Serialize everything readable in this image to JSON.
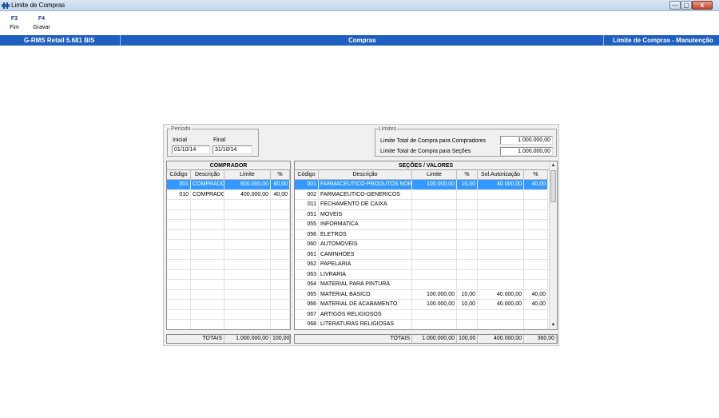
{
  "window": {
    "title": "Limite de Compras",
    "controls": {
      "minimize": "—",
      "maximize": "▢",
      "close": "x"
    }
  },
  "toolbar": [
    {
      "key": "F3",
      "label": "Fim"
    },
    {
      "key": "F4",
      "label": "Gravar"
    }
  ],
  "header": {
    "left": "G-RMS Retail 5.681 BIS",
    "center": "Compras",
    "right": "Limite de Compras - Manutenção"
  },
  "periodo": {
    "legend": "Período",
    "inicial_label": "Inicial",
    "final_label": "Final",
    "inicial": "01/10/14",
    "final": "31/10/14"
  },
  "limites": {
    "legend": "Limites",
    "compradores_label": "Limite Total de Compra para Compradores",
    "compradores_value": "1.000.000,00",
    "secoes_label": "Limite Total de Compra para Seções",
    "secoes_value": "1.000.000,00"
  },
  "comprador": {
    "title": "COMPRADOR",
    "columns": [
      "Código",
      "Descrição",
      "Limite",
      "%"
    ],
    "rows": [
      [
        "001",
        "COMPRADOI",
        "600.000,00",
        "60,00"
      ],
      [
        "010",
        "COMPRADOI",
        "400.000,00",
        "40,00"
      ]
    ],
    "totals": {
      "label": "TOTAIS",
      "limite": "1.000.000,00",
      "pct": "100,00"
    }
  },
  "secoes": {
    "title": "SEÇÕES / VALORES",
    "columns": [
      "Código",
      "Descrição",
      "Limite",
      "%",
      "Sol.Autorização",
      "%"
    ],
    "rows": [
      [
        "001",
        "FARMACEUTICO-PRODUTOS NORMA",
        "100.000,00",
        "10,00",
        "40.000,00",
        "40,00"
      ],
      [
        "002",
        "FARMACEUTICO-GENERICOS",
        "",
        "",
        "",
        ""
      ],
      [
        "011",
        "FECHAMENTO DE CAIXA",
        "",
        "",
        "",
        ""
      ],
      [
        "051",
        "MOVEIS",
        "",
        "",
        "",
        ""
      ],
      [
        "055",
        "INFORMATICA",
        "",
        "",
        "",
        ""
      ],
      [
        "056",
        "ELETROS",
        "",
        "",
        "",
        ""
      ],
      [
        "060",
        "AUTOMOVEIS",
        "",
        "",
        "",
        ""
      ],
      [
        "061",
        "CAMINHOES",
        "",
        "",
        "",
        ""
      ],
      [
        "062",
        "PAPELARIA",
        "",
        "",
        "",
        ""
      ],
      [
        "063",
        "LIVRARIA",
        "",
        "",
        "",
        ""
      ],
      [
        "064",
        "MATERIAL PARA PINTURA",
        "",
        "",
        "",
        ""
      ],
      [
        "065",
        "MATERIAL BASICO",
        "100.000,00",
        "10,00",
        "40.000,00",
        "40,00"
      ],
      [
        "066",
        "MATERIAL DE ACABAMENTO",
        "100.000,00",
        "10,00",
        "40.000,00",
        "40,00"
      ],
      [
        "067",
        "ARTIGOS RELIGIOSOS",
        "",
        "",
        "",
        ""
      ],
      [
        "068",
        "LITERATURAS RELIGIOSAS",
        "",
        "",
        "",
        ""
      ]
    ],
    "totals": {
      "label": "TOTAIS",
      "limite": "1.000.000,00",
      "pct": "100,00",
      "sol": "400.000,00",
      "sol_pct": "360,00"
    }
  }
}
